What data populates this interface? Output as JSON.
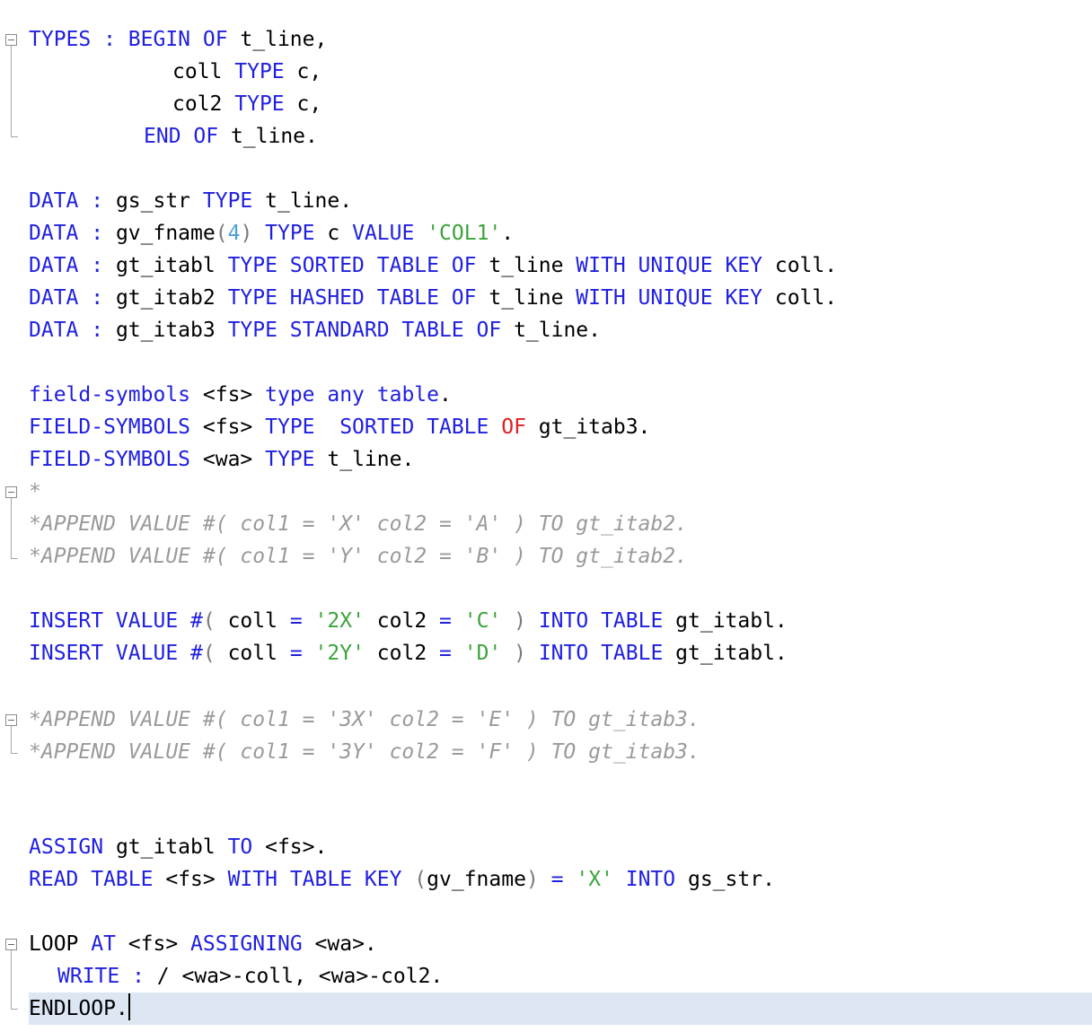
{
  "editor": {
    "code": [
      {
        "segments": [
          [
            "kw",
            "TYPES : BEGIN OF "
          ],
          [
            "dark",
            "t_line,"
          ]
        ]
      },
      {
        "segments": [
          [
            "dark",
            "coll "
          ],
          [
            "kw",
            "TYPE "
          ],
          [
            "dark",
            "c,"
          ]
        ]
      },
      {
        "segments": [
          [
            "dark",
            "col2 "
          ],
          [
            "kw",
            "TYPE "
          ],
          [
            "dark",
            "c,"
          ]
        ]
      },
      {
        "segments": [
          [
            "kw",
            "END OF "
          ],
          [
            "dark",
            "t_line."
          ]
        ]
      },
      {
        "segments": [
          [
            "kw",
            "DATA : "
          ],
          [
            "dark",
            "gs_str "
          ],
          [
            "kw",
            "TYPE "
          ],
          [
            "dark",
            "t_line."
          ]
        ]
      },
      {
        "segments": [
          [
            "kw",
            "DATA : "
          ],
          [
            "dark",
            "gv_fname"
          ],
          [
            "paren",
            "("
          ],
          [
            "num",
            "4"
          ],
          [
            "paren",
            ") "
          ],
          [
            "kw",
            "TYPE "
          ],
          [
            "dark",
            "c "
          ],
          [
            "kw",
            "VALUE "
          ],
          [
            "str",
            "'COL1'"
          ],
          [
            "dark",
            "."
          ]
        ]
      },
      {
        "segments": [
          [
            "kw",
            "DATA : "
          ],
          [
            "dark",
            "gt_itabl "
          ],
          [
            "kw",
            "TYPE SORTED TABLE OF "
          ],
          [
            "dark",
            "t_line "
          ],
          [
            "kw",
            "WITH UNIQUE KEY "
          ],
          [
            "dark",
            "coll."
          ]
        ]
      },
      {
        "segments": [
          [
            "kw",
            "DATA : "
          ],
          [
            "dark",
            "gt_itab2 "
          ],
          [
            "kw",
            "TYPE HASHED TABLE OF "
          ],
          [
            "dark",
            "t_line "
          ],
          [
            "kw",
            "WITH UNIQUE KEY "
          ],
          [
            "dark",
            "coll."
          ]
        ]
      },
      {
        "segments": [
          [
            "kw",
            "DATA : "
          ],
          [
            "dark",
            "gt_itab3 "
          ],
          [
            "kw",
            "TYPE STANDARD TABLE OF "
          ],
          [
            "dark",
            "t_line."
          ]
        ]
      },
      {
        "segments": [
          [
            "kw",
            "field-symbols "
          ],
          [
            "dark",
            "<fs> "
          ],
          [
            "kw",
            "type any table"
          ],
          [
            "dark",
            "."
          ]
        ]
      },
      {
        "segments": [
          [
            "kw",
            "FIELD-SYMBOLS "
          ],
          [
            "dark",
            "<fs> "
          ],
          [
            "kw",
            "TYPE  SORTED TABLE "
          ],
          [
            "red",
            "OF "
          ],
          [
            "dark",
            "gt_itab3."
          ]
        ]
      },
      {
        "segments": [
          [
            "kw",
            "FIELD-SYMBOLS "
          ],
          [
            "dark",
            "<wa> "
          ],
          [
            "kw",
            "TYPE "
          ],
          [
            "dark",
            "t_line."
          ]
        ]
      },
      {
        "segments": [
          [
            "cmt",
            "*"
          ]
        ]
      },
      {
        "segments": [
          [
            "cmt",
            "*APPEND VALUE #( col1 = 'X' col2 = 'A' ) TO gt_itab2."
          ]
        ]
      },
      {
        "segments": [
          [
            "cmt",
            "*APPEND VALUE #( col1 = 'Y' col2 = 'B' ) TO gt_itab2."
          ]
        ]
      },
      {
        "segments": [
          [
            "kw",
            "INSERT VALUE #"
          ],
          [
            "paren",
            "( "
          ],
          [
            "dark",
            "coll "
          ],
          [
            "op",
            "= "
          ],
          [
            "str",
            "'2X' "
          ],
          [
            "dark",
            "col2 "
          ],
          [
            "op",
            "= "
          ],
          [
            "str",
            "'C' "
          ],
          [
            "paren",
            ") "
          ],
          [
            "kw",
            "INTO TABLE "
          ],
          [
            "dark",
            "gt_itabl."
          ]
        ]
      },
      {
        "segments": [
          [
            "kw",
            "INSERT VALUE #"
          ],
          [
            "paren",
            "( "
          ],
          [
            "dark",
            "coll "
          ],
          [
            "op",
            "= "
          ],
          [
            "str",
            "'2Y' "
          ],
          [
            "dark",
            "col2 "
          ],
          [
            "op",
            "= "
          ],
          [
            "str",
            "'D' "
          ],
          [
            "paren",
            ") "
          ],
          [
            "kw",
            "INTO TABLE "
          ],
          [
            "dark",
            "gt_itabl."
          ]
        ]
      },
      {
        "segments": [
          [
            "cmt",
            "*APPEND VALUE #( col1 = '3X' col2 = 'E' ) TO gt_itab3."
          ]
        ]
      },
      {
        "segments": [
          [
            "cmt",
            "*APPEND VALUE #( col1 = '3Y' col2 = 'F' ) TO gt_itab3."
          ]
        ]
      },
      {
        "segments": [
          [
            "kw",
            "ASSIGN "
          ],
          [
            "dark",
            "gt_itabl "
          ],
          [
            "kw",
            "TO "
          ],
          [
            "dark",
            "<fs>."
          ]
        ]
      },
      {
        "segments": [
          [
            "kw",
            "READ TABLE "
          ],
          [
            "dark",
            "<fs> "
          ],
          [
            "kw",
            "WITH TABLE KEY "
          ],
          [
            "paren",
            "("
          ],
          [
            "dark",
            "gv_fname"
          ],
          [
            "paren",
            ") "
          ],
          [
            "op",
            "= "
          ],
          [
            "str",
            "'X' "
          ],
          [
            "kw",
            "INTO "
          ],
          [
            "dark",
            "gs_str."
          ]
        ]
      },
      {
        "segments": [
          [
            "dark",
            "LOOP "
          ],
          [
            "kw",
            "AT "
          ],
          [
            "dark",
            "<fs> "
          ],
          [
            "kw",
            "ASSIGNING "
          ],
          [
            "dark",
            "<wa>."
          ]
        ]
      },
      {
        "segments": [
          [
            "kw",
            "WRITE : "
          ],
          [
            "dark",
            "/ <wa>-coll, <wa>-col2."
          ]
        ]
      },
      {
        "segments": [
          [
            "dark",
            "ENDLOOP."
          ]
        ]
      }
    ]
  }
}
